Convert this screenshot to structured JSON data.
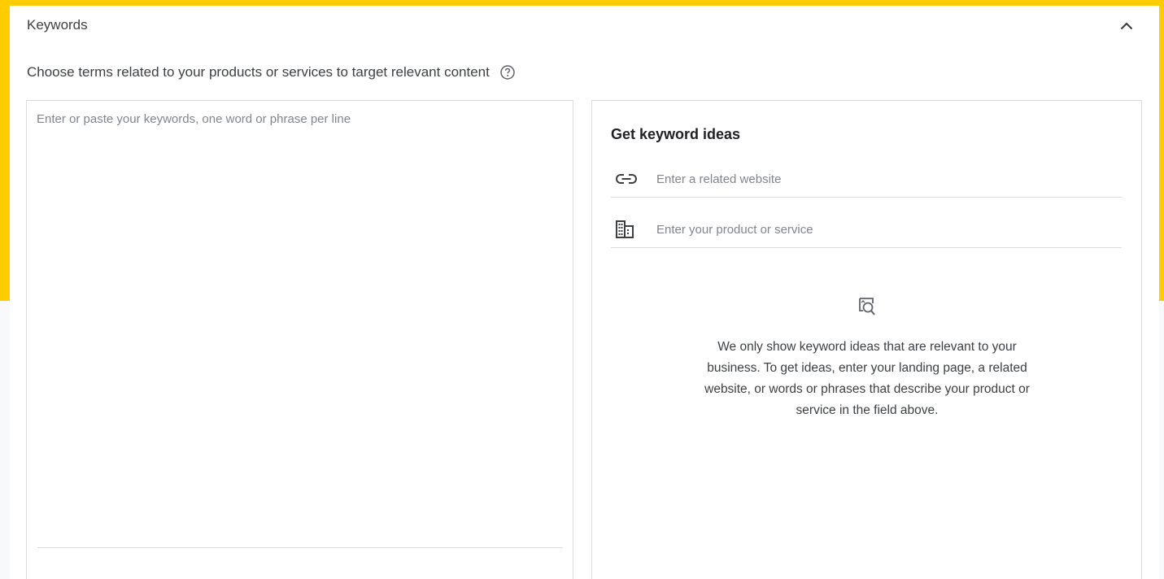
{
  "section": {
    "title": "Keywords",
    "subtitle": "Choose terms related to your products or services to target relevant content"
  },
  "keywords_input": {
    "placeholder": "Enter or paste your keywords, one word or phrase per line",
    "value": ""
  },
  "keyword_ideas": {
    "title": "Get keyword ideas",
    "website_field": {
      "placeholder": "Enter a related website",
      "value": "",
      "icon": "link-icon"
    },
    "product_field": {
      "placeholder": "Enter your product or service",
      "value": "",
      "icon": "business-icon"
    },
    "empty_state": {
      "icon": "image-search-icon",
      "message": "We only show keyword ideas that are relevant to your business. To get ideas, enter your landing page, a related website, or words or phrases that describe your product or service in the field above."
    }
  },
  "icons": {
    "collapse": "chevron-up-icon",
    "help": "help-icon"
  },
  "colors": {
    "frame_accent": "#ffcc00",
    "border": "#dadce0",
    "placeholder": "#80868b",
    "text": "#3c4043"
  }
}
